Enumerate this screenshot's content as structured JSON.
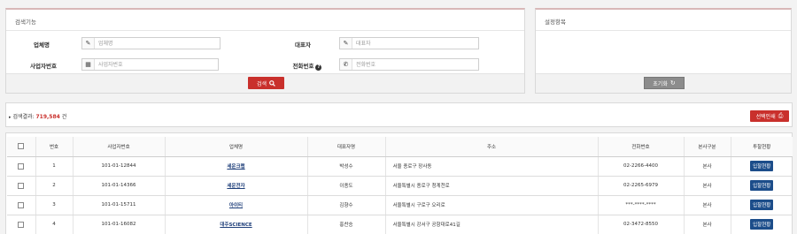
{
  "search": {
    "title": "검색기능",
    "fields": {
      "company": {
        "label": "업체명",
        "placeholder": "업체명",
        "value": ""
      },
      "rep": {
        "label": "대표자",
        "placeholder": "대표자",
        "value": ""
      },
      "bizno": {
        "label": "사업자번호",
        "placeholder": "사업자번호",
        "value": ""
      },
      "phone": {
        "label": "전화번호",
        "placeholder": "전화번호",
        "value": ""
      }
    },
    "button_label": "검색"
  },
  "settings": {
    "title": "설정항목",
    "reset_label": "초기화"
  },
  "result": {
    "prefix": "검색결과:",
    "count": "719,584",
    "suffix": "건",
    "print_label": "선택인쇄"
  },
  "table": {
    "headers": [
      "",
      "번호",
      "사업자번호",
      "업체명",
      "대표자명",
      "주소",
      "전화번호",
      "본사구분",
      "투찰현황"
    ],
    "rows": [
      {
        "no": "1",
        "bizno": "101-01-12844",
        "company": "세운크랩",
        "rep": "박성수",
        "addr": "서울 종로구 장사동",
        "phone": "02-2266-4400",
        "hq": "본사",
        "status": "입찰현황"
      },
      {
        "no": "2",
        "bizno": "101-01-14366",
        "company": "세운전자",
        "rep": "이종도",
        "addr": "서울특별시 종로구 청계천로",
        "phone": "02-2265-6979",
        "hq": "본사",
        "status": "입찰현황"
      },
      {
        "no": "3",
        "bizno": "101-01-15711",
        "company": "아이티",
        "rep": "김향수",
        "addr": "서울특별시 구로구 오리로",
        "phone": "***-****-****",
        "hq": "본사",
        "status": "입찰현황"
      },
      {
        "no": "4",
        "bizno": "101-01-16082",
        "company": "대주SCIENCE",
        "rep": "홍찬승",
        "addr": "서울특별시 강서구 공항대로41길",
        "phone": "02-3472-8550",
        "hq": "본사",
        "status": "입찰현황"
      }
    ]
  },
  "icons": {
    "pencil": "pencil-icon",
    "building": "building-icon",
    "phone": "phone-icon",
    "search": "search-icon",
    "refresh": "refresh-icon",
    "print": "print-icon",
    "help": "help-icon"
  },
  "colors": {
    "accent_red": "#c9302c",
    "badge_blue": "#1c4d8a",
    "link_blue": "#1f3f7a"
  }
}
